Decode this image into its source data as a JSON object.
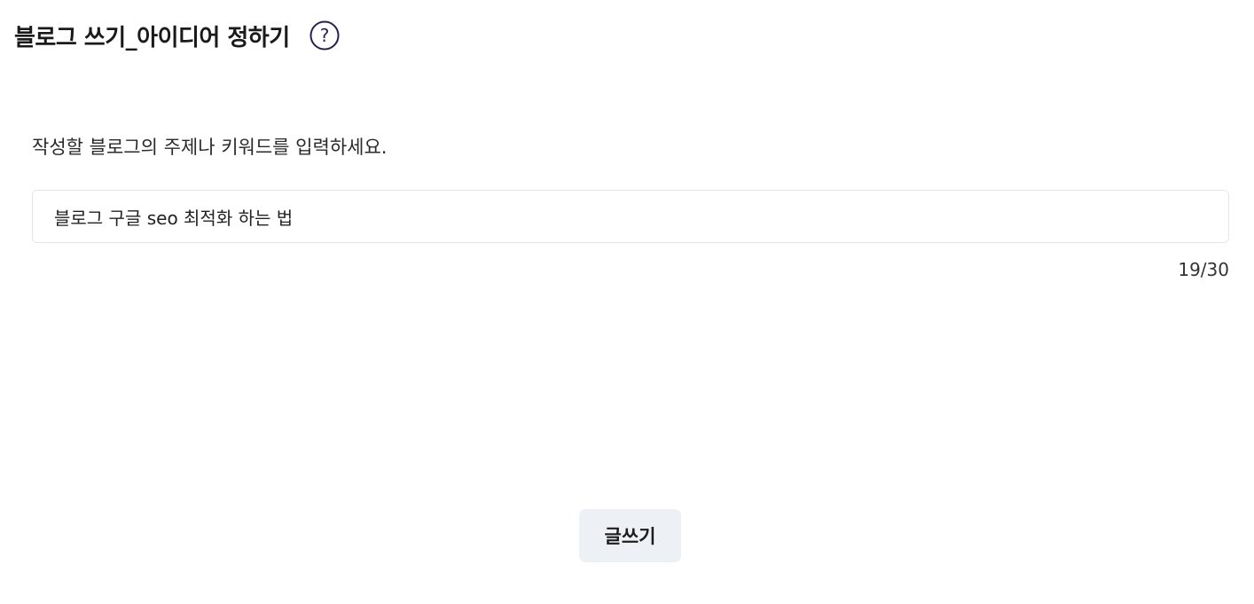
{
  "header": {
    "title": "블로그 쓰기_아이디어 정하기",
    "help_icon": "question-circle-icon",
    "accent_color": "#2b1f4f"
  },
  "form": {
    "prompt": "작성할 블로그의 주제나 키워드를 입력하세요.",
    "topic_value": "블로그 구글 seo 최적화 하는 법",
    "char_count": "19/30"
  },
  "actions": {
    "write_label": "글쓰기"
  }
}
